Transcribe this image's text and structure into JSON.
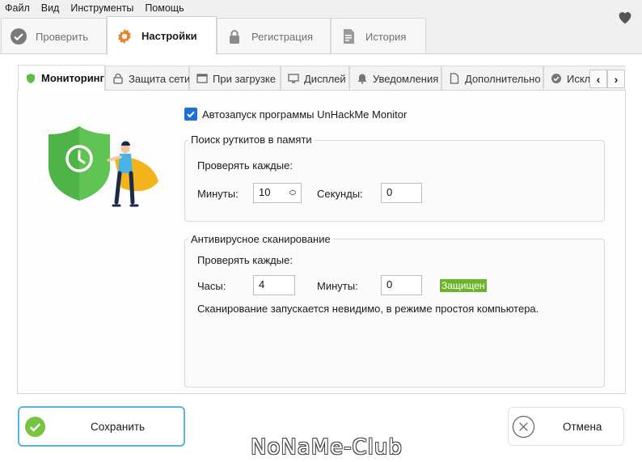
{
  "menu": [
    "Файл",
    "Вид",
    "Инструменты",
    "Помощь"
  ],
  "main_tabs": [
    {
      "label": "Проверить",
      "icon": "check-circle-icon"
    },
    {
      "label": "Настройки",
      "icon": "gear-icon",
      "active": true
    },
    {
      "label": "Регистрация",
      "icon": "lock-icon"
    },
    {
      "label": "История",
      "icon": "document-icon"
    }
  ],
  "inner_tabs": [
    {
      "label": "Мониторинг",
      "icon": "shield-icon",
      "active": true
    },
    {
      "label": "Защита сети",
      "icon": "lock-icon"
    },
    {
      "label": "При загрузке",
      "icon": "window-icon"
    },
    {
      "label": "Дисплей",
      "icon": "monitor-icon"
    },
    {
      "label": "Уведомления",
      "icon": "bell-icon"
    },
    {
      "label": "Дополнительно",
      "icon": "page-icon"
    },
    {
      "label": "Исклю",
      "icon": "check-circle-icon"
    }
  ],
  "scroll": {
    "left": "‹",
    "right": "›"
  },
  "monitoring": {
    "autostart_label": "Автозапуск программы UnHackMe Monitor",
    "autostart_checked": true,
    "rootkit_group": {
      "title": "Поиск руткитов в памяти",
      "check_every": "Проверять каждые:",
      "minutes_label": "Минуты:",
      "minutes_value": "10",
      "seconds_label": "Секунды:",
      "seconds_value": "0"
    },
    "antivirus_group": {
      "title": "Антивирусное сканирование",
      "check_every": "Проверять каждые:",
      "hours_label": "Часы:",
      "hours_value": "4",
      "minutes_label": "Минуты:",
      "minutes_value": "0",
      "status_badge": "Защищен",
      "note": "Сканирование запускается невидимо, в режиме простоя компьютера."
    }
  },
  "buttons": {
    "save": "Сохранить",
    "cancel": "Отмена"
  },
  "watermark": "NoNaMe-Club",
  "colors": {
    "accent_blue": "#1e6fd9",
    "save_border": "#56b6df",
    "badge_green": "#6cb42c",
    "shield_green": "#5fbf45"
  }
}
